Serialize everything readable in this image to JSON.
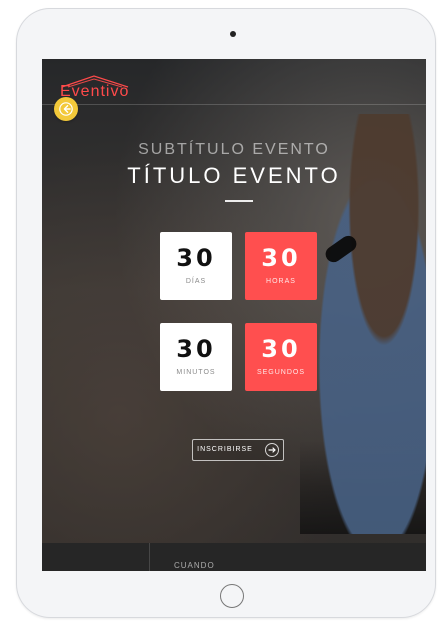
{
  "brand": {
    "name": "Eventivo",
    "accent": "#ff4a4a"
  },
  "hero": {
    "subtitle": "SUBTÍTULO EVENTO",
    "title": "TÍTULO EVENTO"
  },
  "countdown": [
    {
      "value": "30",
      "label": "DÍAS",
      "style": "white"
    },
    {
      "value": "30",
      "label": "HORAS",
      "style": "red"
    },
    {
      "value": "30",
      "label": "MINUTOS",
      "style": "white"
    },
    {
      "value": "30",
      "label": "SEGUNDOS",
      "style": "red"
    }
  ],
  "cta": {
    "label": "INSCRIBIRSE",
    "icon": "arrow-right-circle-icon"
  },
  "bottom": {
    "label": "CUANDO"
  },
  "icons": {
    "back": "back-arrow-icon"
  }
}
